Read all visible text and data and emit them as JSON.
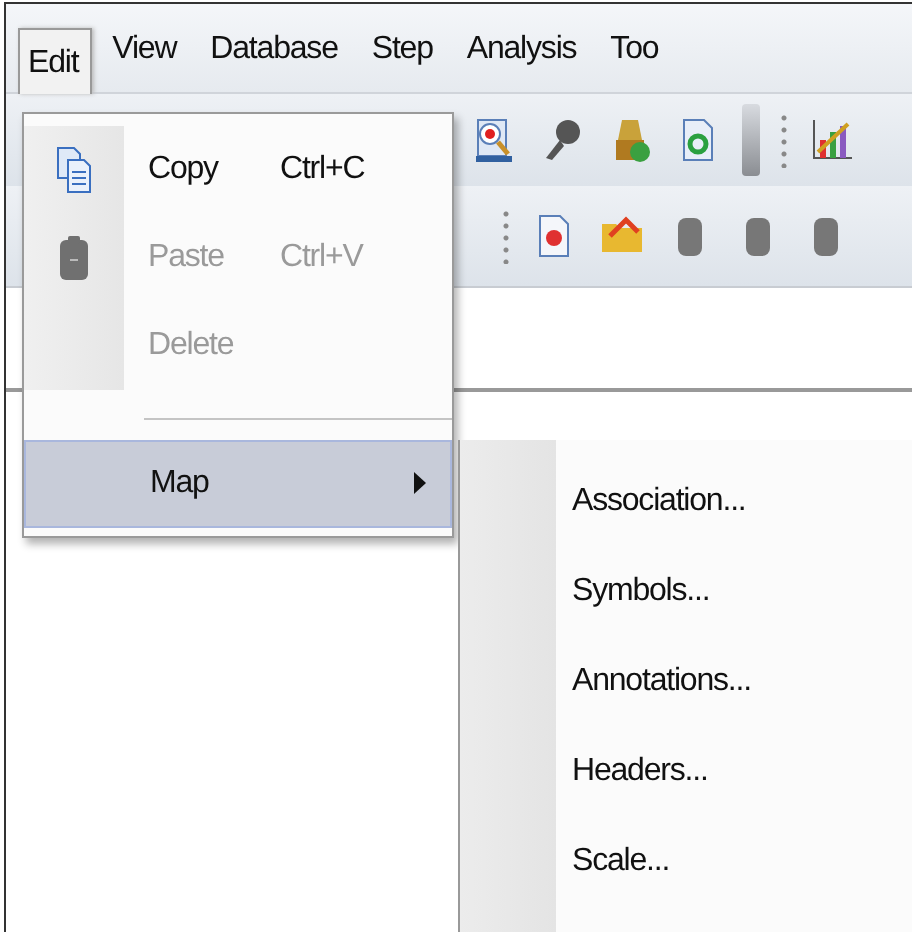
{
  "menubar": [
    {
      "label": "Edit",
      "selected": true
    },
    {
      "label": "View",
      "selected": false
    },
    {
      "label": "Database",
      "selected": false
    },
    {
      "label": "Step",
      "selected": false
    },
    {
      "label": "Analysis",
      "selected": false
    },
    {
      "label": "Too",
      "selected": false
    }
  ],
  "edit_menu": [
    {
      "kind": "item",
      "label": "Copy",
      "shortcut": "Ctrl+C",
      "disabled": false,
      "selected": false,
      "submenu": false
    },
    {
      "kind": "item",
      "label": "Paste",
      "shortcut": "Ctrl+V",
      "disabled": true,
      "selected": false,
      "submenu": false
    },
    {
      "kind": "item",
      "label": "Delete",
      "disabled": true,
      "selected": false,
      "submenu": false
    },
    {
      "kind": "separator"
    },
    {
      "kind": "item",
      "label": "Map",
      "disabled": false,
      "selected": true,
      "submenu": true
    }
  ],
  "map_submenu": [
    {
      "label": "Association..."
    },
    {
      "label": "Symbols..."
    },
    {
      "label": "Annotations..."
    },
    {
      "label": "Headers..."
    },
    {
      "label": "Scale..."
    }
  ]
}
